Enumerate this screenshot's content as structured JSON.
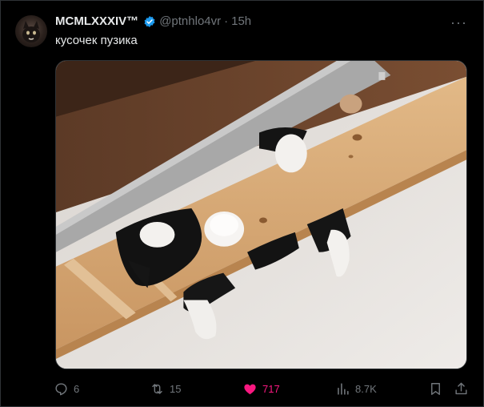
{
  "tweet": {
    "display_name": "MCMLXXXIV™",
    "handle": "@ptnhlo4vr",
    "separator": "·",
    "time": "15h",
    "more": "···",
    "text": "кусочек пузика",
    "verified": true
  },
  "actions": {
    "replies": "6",
    "reposts": "15",
    "likes": "717",
    "views": "8.7K"
  },
  "colors": {
    "background": "#000000",
    "text": "#e7e9ea",
    "muted": "#71767b",
    "verified": "#1d9bf0",
    "like": "#f91880"
  },
  "icons": [
    "more-icon",
    "verified-icon",
    "reply-icon",
    "repost-icon",
    "like-icon",
    "views-icon",
    "bookmark-icon",
    "share-icon"
  ]
}
